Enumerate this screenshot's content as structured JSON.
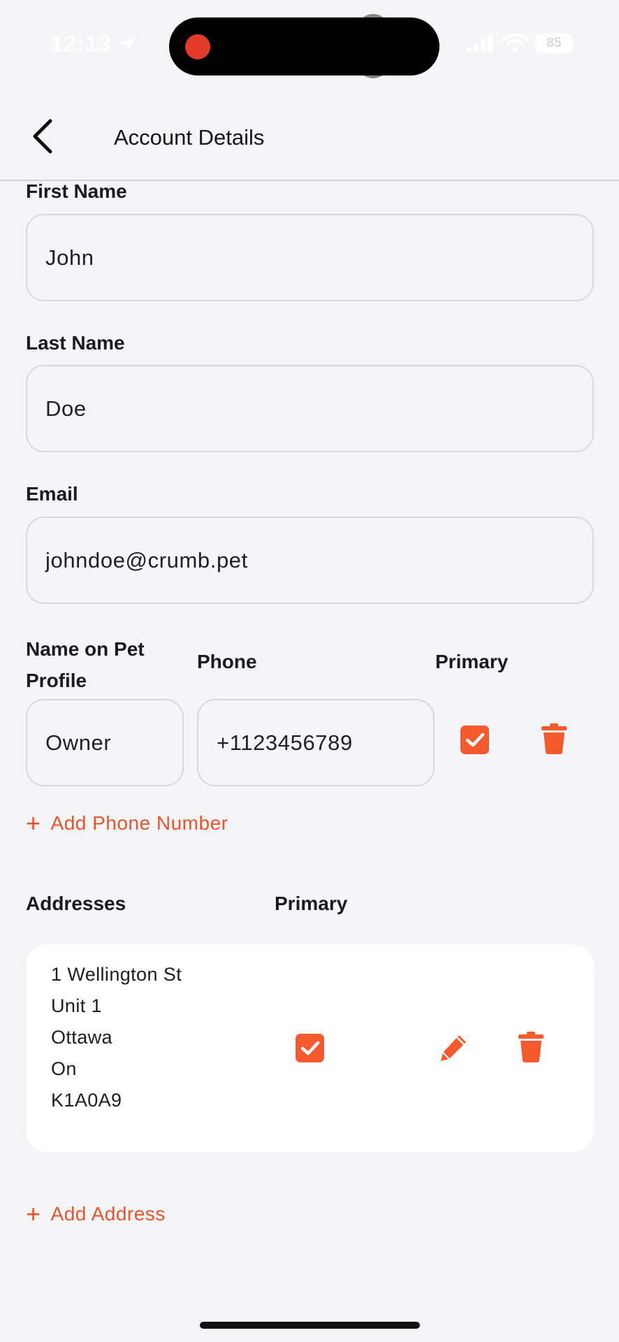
{
  "status": {
    "time": "12:13",
    "battery": "85"
  },
  "header": {
    "title": "Account Details"
  },
  "form": {
    "first_name_label": "First Name",
    "first_name_value": "John",
    "last_name_label": "Last Name",
    "last_name_value": "Doe",
    "email_label": "Email",
    "email_value": "johndoe@crumb.pet"
  },
  "phones": {
    "name_label": "Name on Pet Profile",
    "phone_label": "Phone",
    "primary_label": "Primary",
    "entries": [
      {
        "name": "Owner",
        "phone": "+1123456789",
        "primary": true
      }
    ],
    "add_label": "Add Phone Number"
  },
  "addresses": {
    "header_label": "Addresses",
    "primary_label": "Primary",
    "entries": [
      {
        "lines": [
          "1 Wellington St",
          "Unit 1",
          "Ottawa",
          "On",
          "K1A0A9"
        ],
        "primary": true
      }
    ],
    "add_label": "Add Address"
  },
  "colors": {
    "accent": "#f45a2d",
    "link": "#e8552a",
    "background": "#f5f4f7"
  }
}
